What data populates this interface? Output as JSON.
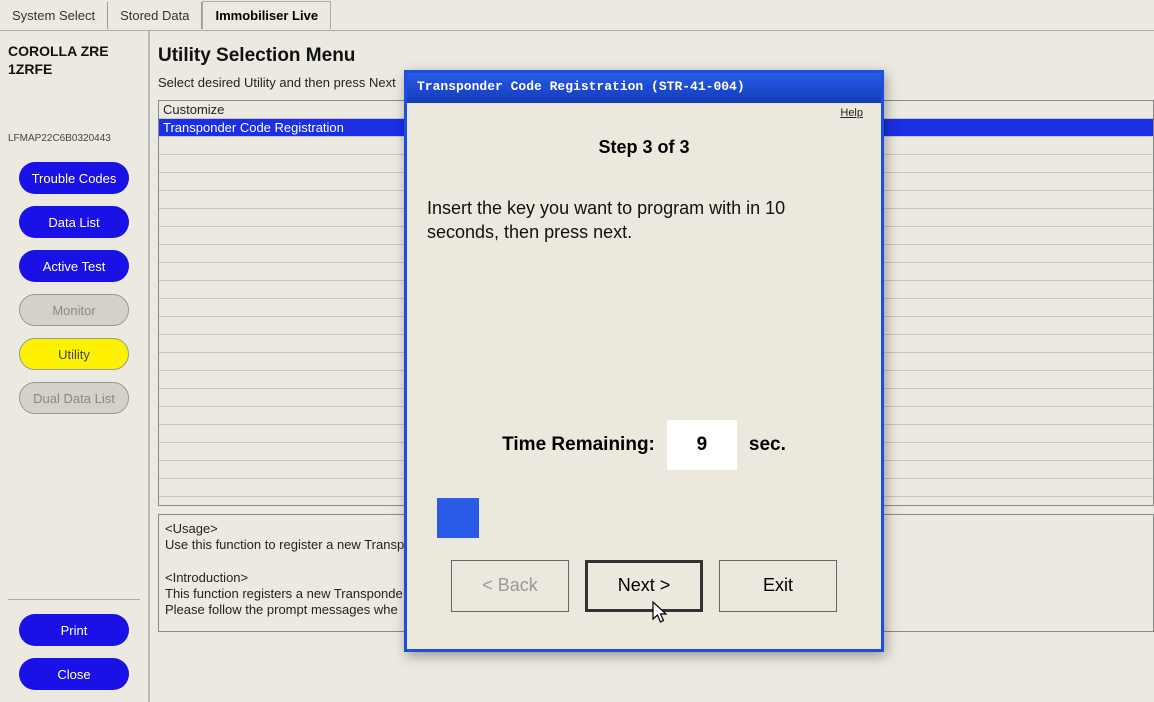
{
  "tabs": {
    "system_select": "System Select",
    "stored_data": "Stored Data",
    "immobiliser_live": "Immobiliser Live"
  },
  "sidebar": {
    "vehicle": "COROLLA ZRE 1ZRFE",
    "ecu_id": "LFMAP22C6B0320443",
    "buttons": {
      "trouble_codes": "Trouble Codes",
      "data_list": "Data List",
      "active_test": "Active Test",
      "monitor": "Monitor",
      "utility": "Utility",
      "dual_data_list": "Dual Data List",
      "print": "Print",
      "close": "Close"
    }
  },
  "content": {
    "title": "Utility Selection Menu",
    "subtitle": "Select desired Utility and then press Next",
    "list": {
      "customize": "Customize",
      "transponder": "Transponder Code Registration"
    },
    "usage_title": "<Usage>",
    "usage_text": "Use this function to register a new Transp",
    "intro_title": "<Introduction>",
    "intro_line1": "This function registers a new Transponde",
    "intro_line2": "Please follow the prompt messages whe"
  },
  "dialog": {
    "title": "Transponder Code Registration (STR-41-004)",
    "help": "Help",
    "step": "Step 3 of 3",
    "instruction": "Insert the key you want to program with in 10 seconds, then press next.",
    "time_label": "Time Remaining:",
    "time_value": "9",
    "time_unit": "sec.",
    "back": "< Back",
    "next": "Next >",
    "exit": "Exit"
  }
}
